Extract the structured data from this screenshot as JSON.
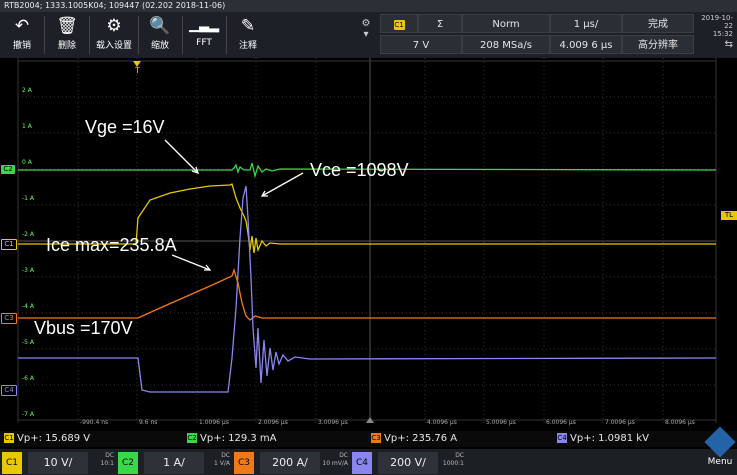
{
  "titlebar": {
    "text": "RTB2004; 1333.1005K04; 109447 (02.202 2018-11-06)"
  },
  "toolbar": {
    "items": [
      {
        "label": "撤销",
        "icon": "undo-icon"
      },
      {
        "label": "删除",
        "icon": "trash-icon"
      },
      {
        "label": "载入设置",
        "icon": "settings-icon"
      },
      {
        "label": "缩放",
        "icon": "zoom-icon"
      },
      {
        "label": "FFT",
        "icon": "fft-icon"
      },
      {
        "label": "注释",
        "icon": "pen-icon"
      }
    ]
  },
  "trigger": {
    "channel": "C1",
    "slope": "Ʃ",
    "mode": "Norm",
    "level": "7 V",
    "sample_rate": "208 MSa/s",
    "timebase": "1 µs/",
    "position": "4.009 6 µs",
    "status": "完成",
    "acq_mode": "高分辨率"
  },
  "date": {
    "date": "2019-10-22",
    "time": "15:32"
  },
  "y_axis_labels": [
    "2 A",
    "1 A",
    "0 A",
    "-1 A",
    "-2 A",
    "-3 A",
    "-4 A",
    "-5 A",
    "-6 A",
    "-7 A"
  ],
  "x_axis_labels": [
    "-990.4 ns",
    "9.6 ns",
    "1.0096 µs",
    "2.0096 µs",
    "3.0096 µs",
    "4.0096 µs",
    "5.0096 µs",
    "6.0096 µs",
    "7.0096 µs",
    "8.0096 µs"
  ],
  "channel_tags": {
    "c1": "C1",
    "c2": "C2",
    "c3": "C3",
    "c4": "C4",
    "trigger": "T",
    "trigger_level": "TL"
  },
  "annotations": {
    "vge": "Vge =16V",
    "vce": "Vce =1098V",
    "ice": "Ice max=235.8A",
    "vbus": "Vbus =170V"
  },
  "measurements": {
    "c1": "Vp+: 15.689 V",
    "c2": "Vp+: 129.3 mA",
    "c3": "Vp+: 235.76 A",
    "c4": "Vp+: 1.0981 kV"
  },
  "channels": [
    {
      "tag": "C1",
      "scale": "10 V/",
      "coupling": "DC",
      "probe": "10:1",
      "color": "#e8c800"
    },
    {
      "tag": "C2",
      "scale": "1 A/",
      "coupling": "DC",
      "probe": "1 V/A",
      "color": "#39d84a"
    },
    {
      "tag": "C3",
      "scale": "200 A/",
      "coupling": "DC",
      "probe": "10 mV/A",
      "color": "#f07a18"
    },
    {
      "tag": "C4",
      "scale": "200 V/",
      "coupling": "DC",
      "probe": "1000:1",
      "color": "#8a86f0"
    }
  ],
  "menu": {
    "label": "Menu"
  },
  "colors": {
    "c1": "#e8c800",
    "c2": "#39d84a",
    "c3": "#f07a18",
    "c4": "#8a86f0",
    "grid": "#3a3a3a"
  }
}
